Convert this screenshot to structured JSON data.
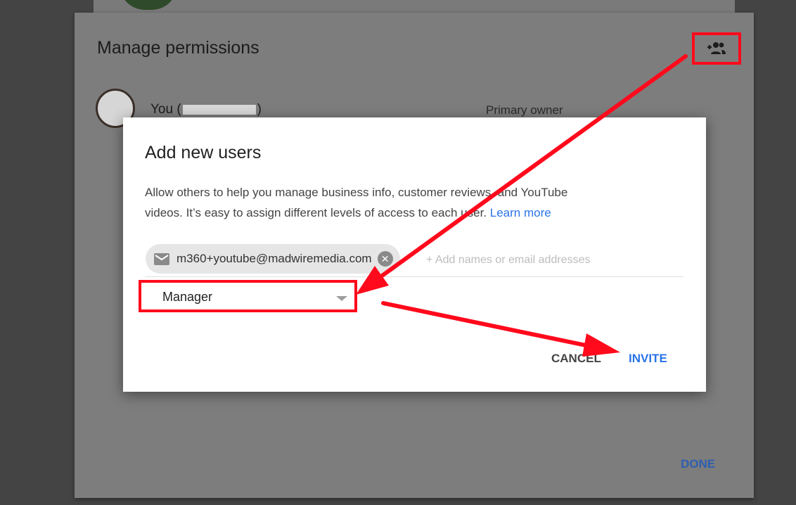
{
  "background": {
    "overlay_color": "#444444"
  },
  "manage_permissions": {
    "title": "Manage permissions",
    "add_user_icon": "person-add-icon",
    "owner": {
      "name_prefix": "You (",
      "name_suffix": ")",
      "role": "Primary owner"
    },
    "done_label": "DONE"
  },
  "add_users_dialog": {
    "title": "Add new users",
    "description_line1": "Allow others to help you manage business info, customer reviews, and YouTube",
    "description_line2": "videos. It’s easy to assign different levels of access to each user.",
    "learn_more": "Learn more",
    "chip": {
      "icon": "mail-icon",
      "email": "m360+youtube@madwiremedia.com",
      "remove_icon": "close-icon",
      "remove_glyph": "✕"
    },
    "email_placeholder": "+ Add names or email addresses",
    "role_value": "Manager",
    "cancel_label": "CANCEL",
    "invite_label": "INVITE"
  },
  "annotation": {
    "color": "#ff0a1c"
  }
}
